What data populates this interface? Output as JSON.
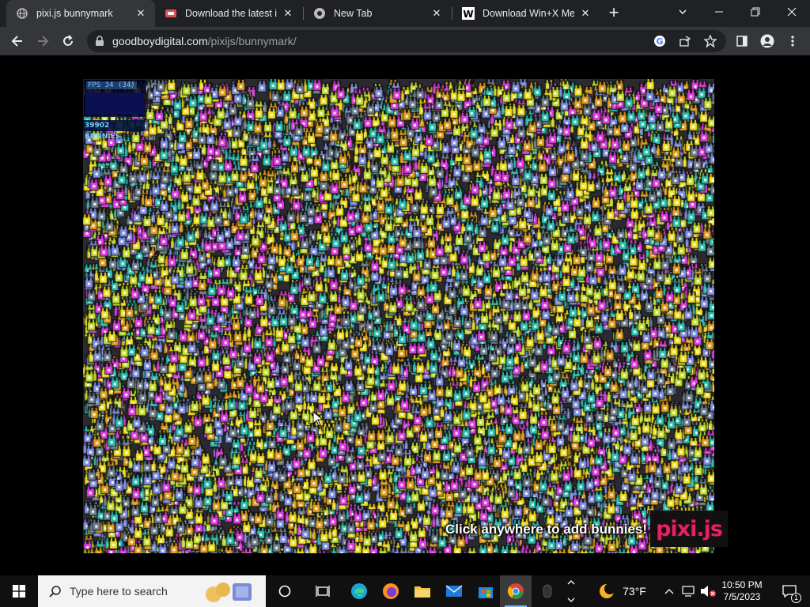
{
  "browser": {
    "tabs": [
      {
        "title": "pixi.js bunnymark",
        "active": true
      },
      {
        "title": "Download the latest incr",
        "active": false
      },
      {
        "title": "New Tab",
        "active": false
      },
      {
        "title": "Download Win+X Men",
        "active": false
      }
    ],
    "url_host": "goodboydigital.com",
    "url_path": "/pixijs/bunnymark/"
  },
  "page": {
    "fps_label": "FPS 34 (34)",
    "bunny_count": "39902 BUNNIES",
    "hint": "Click anywhere to add bunnies!",
    "logo": "pixi.js"
  },
  "taskbar": {
    "search_placeholder": "Type here to search",
    "weather": "73°F",
    "time": "10:50 PM",
    "date": "7/5/2023",
    "notification_count": "1"
  },
  "colors": {
    "bunny_palette": [
      "#f0e020",
      "#c8e030",
      "#e040e0",
      "#30c0b0",
      "#8090e0",
      "#e0a020",
      "#708090",
      "#ffffff"
    ]
  }
}
